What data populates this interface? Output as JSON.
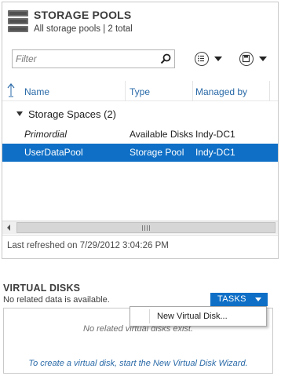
{
  "storage_pools": {
    "title": "STORAGE POOLS",
    "subtitle": "All storage pools | 2 total",
    "filter": {
      "placeholder": "Filter"
    },
    "columns": [
      "Name",
      "Type",
      "Managed by"
    ],
    "group": {
      "label": "Storage Spaces (2)"
    },
    "rows": [
      {
        "name": "Primordial",
        "type": "Available Disks",
        "managed_by": "Indy-DC1",
        "selected": false
      },
      {
        "name": "UserDataPool",
        "type": "Storage Pool",
        "managed_by": "Indy-DC1",
        "selected": true
      }
    ],
    "last_refreshed": "Last refreshed on 7/29/2012 3:04:26 PM",
    "icons": {
      "header": "database-icon",
      "search": "search-icon",
      "view": "list-view-icon",
      "save": "save-icon"
    }
  },
  "virtual_disks": {
    "title": "VIRTUAL DISKS",
    "subtitle": "No related data is available.",
    "tasks_label": "TASKS",
    "empty_message": "No related virtual disks exist.",
    "create_link": "To create a virtual disk, start the New Virtual Disk Wizard.",
    "tasks_menu": [
      "New Virtual Disk..."
    ]
  },
  "colors": {
    "accent": "#0f6fc6",
    "link": "#2a6aa8",
    "selected_row": "#0f6fc6"
  }
}
